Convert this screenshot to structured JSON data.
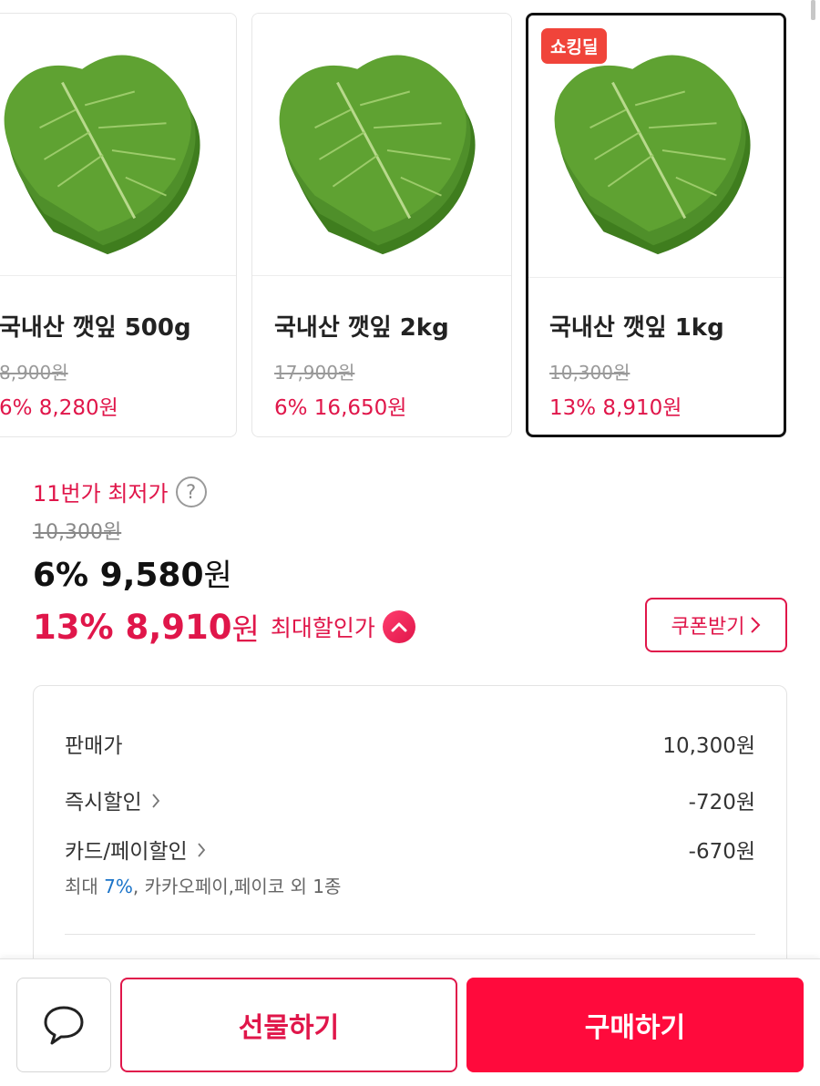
{
  "options": [
    {
      "name": "국내산 깻잎 500g",
      "original_price": "8,900원",
      "discount_price": "6% 8,280원",
      "selected": false,
      "badge": ""
    },
    {
      "name": "국내산 깻잎 2kg",
      "original_price": "17,900원",
      "discount_price": "6% 16,650원",
      "selected": false,
      "badge": ""
    },
    {
      "name": "국내산 깻잎 1kg",
      "original_price": "10,300원",
      "discount_price": "13% 8,910원",
      "selected": true,
      "badge": "쇼킹딜"
    }
  ],
  "price": {
    "lowest_label": "11번가 최저가",
    "help_symbol": "?",
    "list_price": "10,300원",
    "main_amount": "6% 9,580",
    "main_currency": "원",
    "max_amount": "13% 8,910",
    "max_currency": "원",
    "max_label": "최대할인가",
    "coupon_label": "쿠폰받기"
  },
  "breakdown": {
    "rows": [
      {
        "label": "판매가",
        "value": "10,300원"
      },
      {
        "label": "즉시할인",
        "value": "-720원"
      },
      {
        "label": "카드/페이할인",
        "value": "-670원"
      }
    ],
    "card_note_prefix": "최대 ",
    "card_note_pct": "7%",
    "card_note_suffix": ", 카카오페이,페이코 외 1종"
  },
  "bottom_bar": {
    "gift_label": "선물하기",
    "buy_label": "구매하기"
  },
  "colors": {
    "accent": "#e0164a",
    "buy_button": "#ff0a3c",
    "deal_badge": "#f0443a",
    "link_blue": "#1a73c8"
  },
  "icons": {
    "help": "help-icon",
    "chevron_up": "chevron-up-icon",
    "chevron_right": "chevron-right-icon",
    "chat": "chat-bubble-icon"
  }
}
